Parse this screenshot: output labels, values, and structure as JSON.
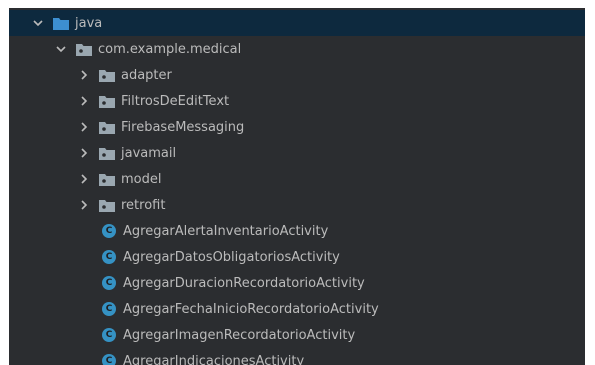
{
  "tree": {
    "root": {
      "label": "java",
      "icon": "source-folder-icon",
      "expanded": true
    },
    "package": {
      "label": "com.example.medical",
      "icon": "package-icon",
      "expanded": true
    },
    "subpackages": [
      {
        "label": "adapter",
        "icon": "package-icon",
        "expanded": false
      },
      {
        "label": "FiltrosDeEditText",
        "icon": "package-icon",
        "expanded": false
      },
      {
        "label": "FirebaseMessaging",
        "icon": "package-icon",
        "expanded": false
      },
      {
        "label": "javamail",
        "icon": "package-icon",
        "expanded": false
      },
      {
        "label": "model",
        "icon": "package-icon",
        "expanded": false
      },
      {
        "label": "retrofit",
        "icon": "package-icon",
        "expanded": false
      }
    ],
    "classes": [
      {
        "label": "AgregarAlertaInventarioActivity",
        "icon": "class-icon",
        "glyph": "C"
      },
      {
        "label": "AgregarDatosObligatoriosActivity",
        "icon": "class-icon",
        "glyph": "C"
      },
      {
        "label": "AgregarDuracionRecordatorioActivity",
        "icon": "class-icon",
        "glyph": "C"
      },
      {
        "label": "AgregarFechaInicioRecordatorioActivity",
        "icon": "class-icon",
        "glyph": "C"
      },
      {
        "label": "AgregarImagenRecordatorioActivity",
        "icon": "class-icon",
        "glyph": "C"
      },
      {
        "label": "AgregarIndicacionesActivity",
        "icon": "class-icon",
        "glyph": "C"
      }
    ]
  },
  "colors": {
    "panel_bg": "#2b2d30",
    "selected_row": "#0d293e",
    "text": "#bbbbbb",
    "source_folder": "#3d8fd1",
    "package_folder": "#9aa7b0",
    "class_icon": "#3592c4"
  }
}
